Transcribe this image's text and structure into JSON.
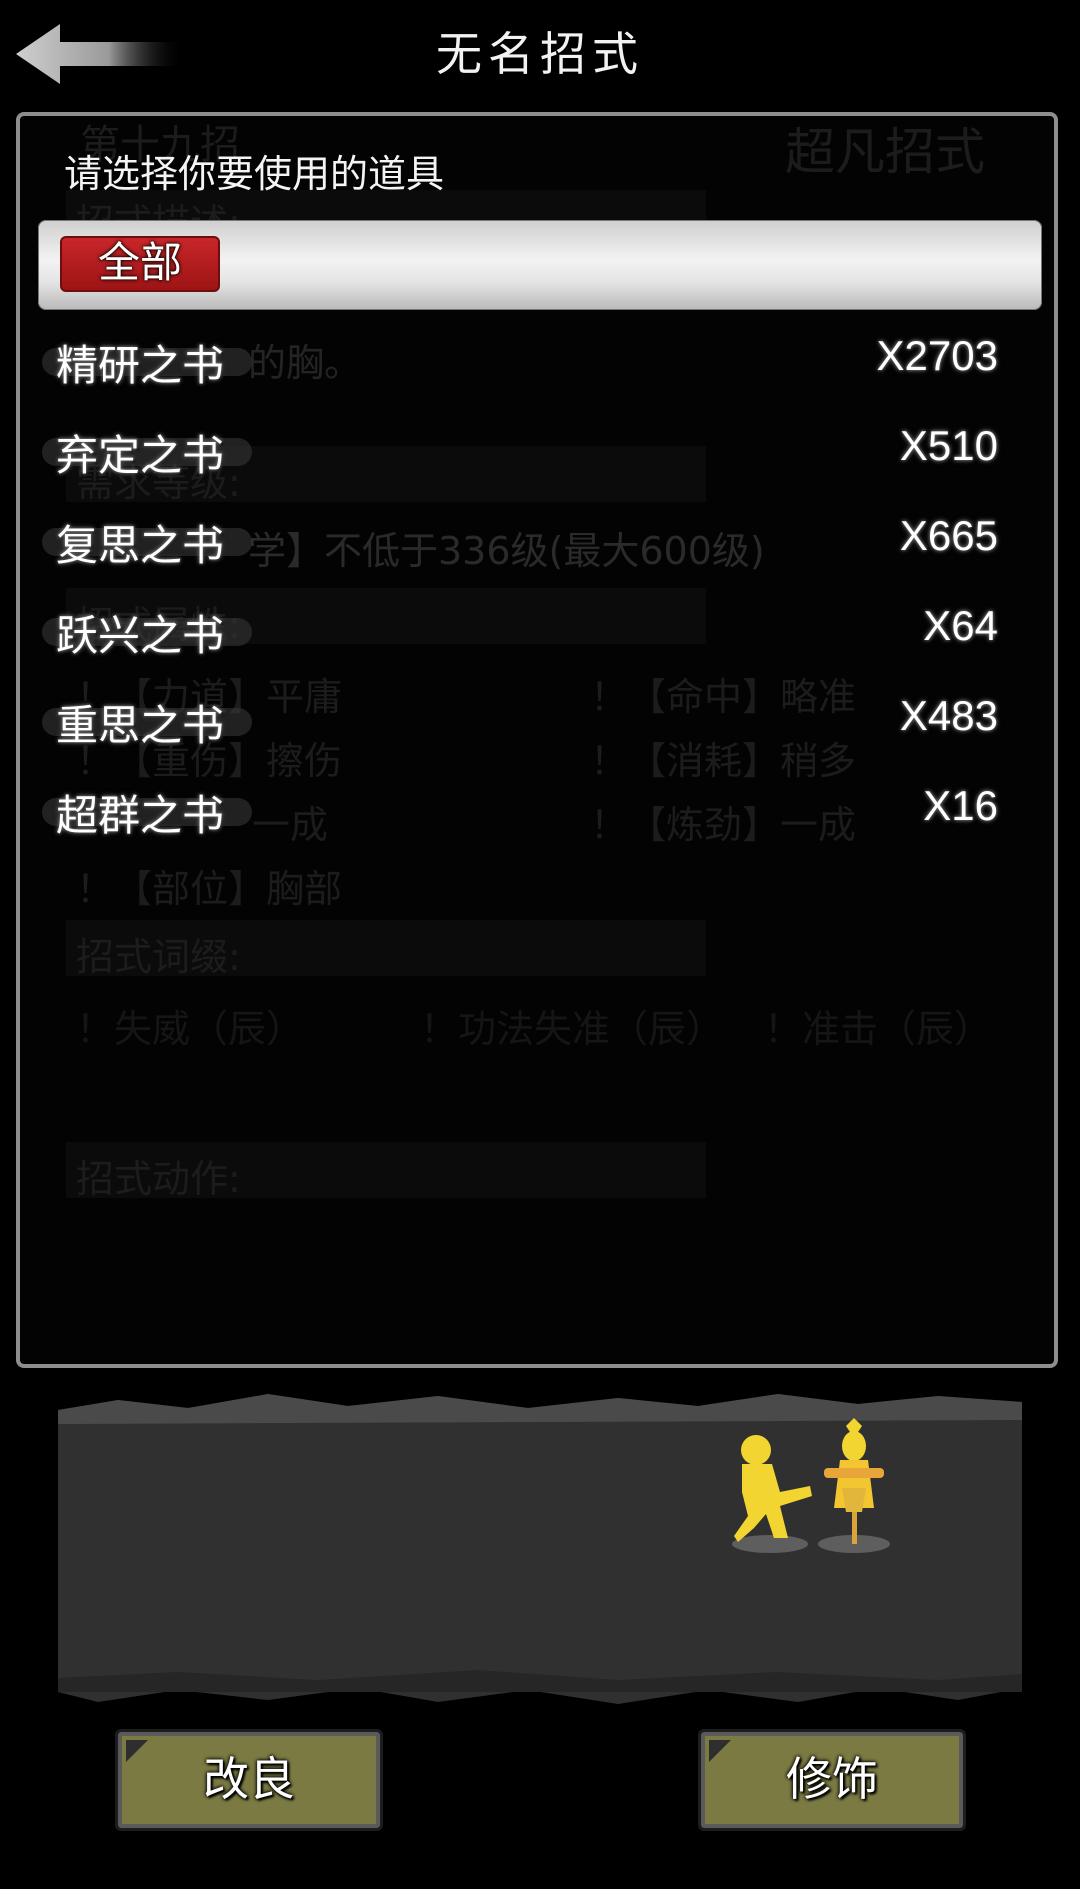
{
  "header": {
    "title": "无名招式",
    "back_icon": "back-arrow-icon"
  },
  "background_detail": {
    "move_number": "第十九招",
    "move_grade": "超凡招式",
    "desc_label": "招式描述:",
    "desc_text_end": "的胸。",
    "req_label": "需求等级:",
    "req_text": "学】不低于336级(最大600级)",
    "attr_label": "招式属性:",
    "attrs": [
      "！【力道】平庸",
      "！【命中】略准",
      "！【重伤】擦伤",
      "！【消耗】稍多",
      "一成",
      "！【炼劲】一成",
      "！【部位】胸部"
    ],
    "affix_label": "招式词缀:",
    "affixes": [
      "！失威（辰）",
      "！功法失准（辰）",
      "！准击（辰）"
    ],
    "action_label": "招式动作:"
  },
  "item_dialog": {
    "prompt": "请选择你要使用的道具",
    "filter_label": "全部",
    "items": [
      {
        "name": "精研之书",
        "qty": "X2703"
      },
      {
        "name": "弃定之书",
        "qty": "X510"
      },
      {
        "name": "复思之书",
        "qty": "X665"
      },
      {
        "name": "跃兴之书",
        "qty": "X64"
      },
      {
        "name": "重思之书",
        "qty": "X483"
      },
      {
        "name": "超群之书",
        "qty": "X16"
      }
    ]
  },
  "buttons": {
    "improve": "改良",
    "decorate": "修饰"
  },
  "colors": {
    "panel_border": "#8e8e8e",
    "filter_chip": "#b41c1f",
    "button_fill": "#7b7a43",
    "figure_yellow": "#f3d531",
    "scene_ground": "#303030"
  }
}
